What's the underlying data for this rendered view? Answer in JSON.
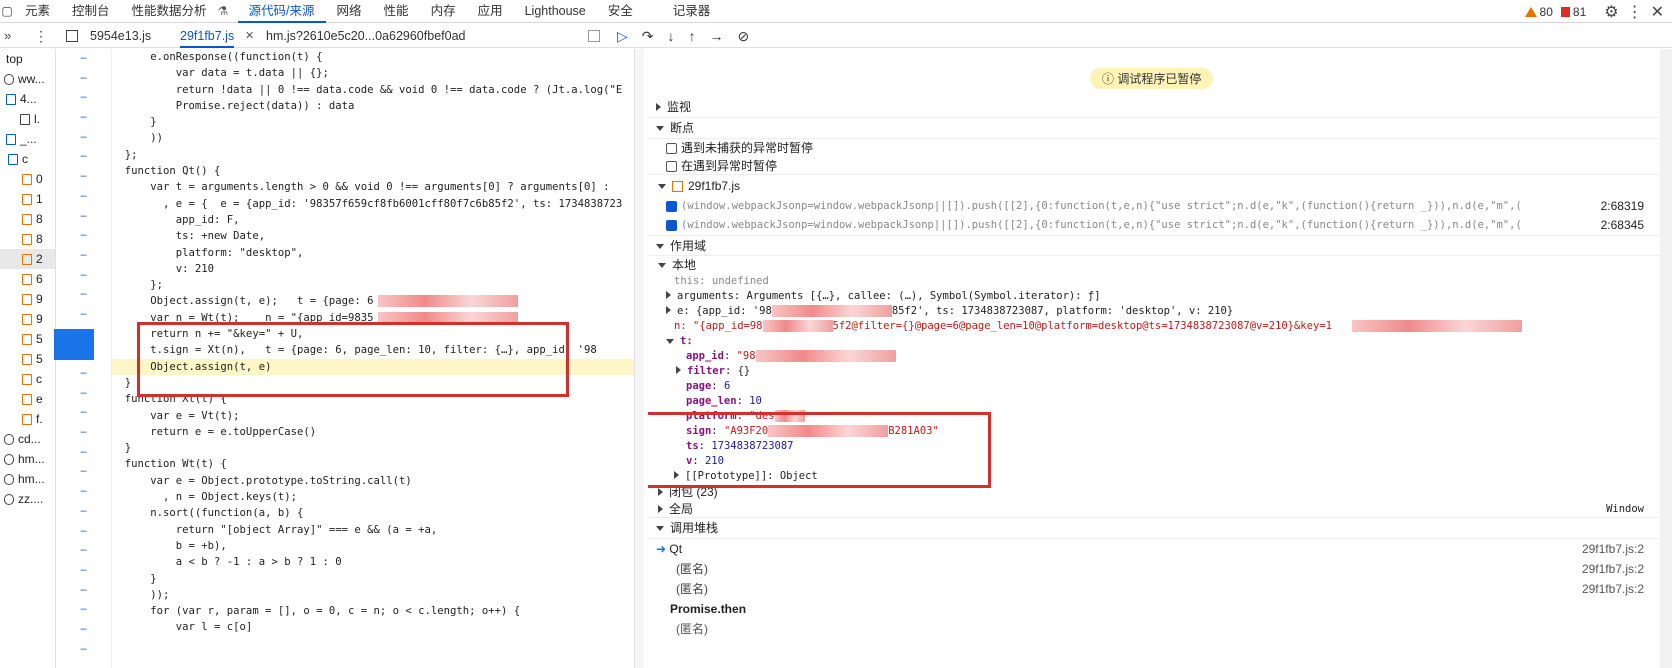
{
  "topbar": {
    "tabs": [
      "元素",
      "控制台",
      "性能数据分析",
      "源代码/来源",
      "网络",
      "性能",
      "内存",
      "应用",
      "Lighthouse",
      "安全",
      "记录器"
    ],
    "warnings": "80",
    "errors": "81"
  },
  "files": {
    "tabs": [
      "5954e13.js",
      "29f1fb7.js",
      "hm.js?2610e5c20...0a62960fbef0ad"
    ]
  },
  "tree": {
    "items": [
      "top",
      "ww...",
      "4...",
      "l.",
      "_...",
      "c",
      "0",
      "1",
      "8",
      "8",
      "2",
      "6",
      "9",
      "9",
      "5",
      "5",
      "c",
      "e",
      "f.",
      "cd...",
      "hm...",
      "hm...",
      "zz...."
    ]
  },
  "code": {
    "lines": [
      "      e.onResponse((function(t) {",
      "          var data = t.data || {};",
      "          return !data || 0 !== data.code && void 0 !== data.code ? (Jt.a.log(\"E",
      "          Promise.reject(data)) : data",
      "      }",
      "      ))",
      "  };",
      "  function Qt() {",
      "      var t = arguments.length > 0 && void 0 !== arguments[0] ? arguments[0] : ",
      "        , e = {  e = {app_id: '98357f659cf8fb6001cff80f7c6b85f2', ts: 1734838723",
      "          app_id: F,",
      "          ts: +new Date,",
      "          platform: \"desktop\",",
      "          v: 210",
      "      };",
      "      Object.assign(t, e);   t = {page: 6",
      "      var n = Wt(t);    n = \"{app_id=9835",
      "      return n += \"&key=\" + U,",
      "      t.sign = Xt(n),   t = {page: 6, page_len: 10, filter: {…}, app_id: '98",
      "      Object.assign(t, e)",
      "  }",
      "  function Xt(t) {",
      "      var e = Vt(t);",
      "      return e = e.toUpperCase()",
      "  }",
      "  function Wt(t) {",
      "      var e = Object.prototype.toString.call(t)",
      "        , n = Object.keys(t);",
      "      n.sort((function(a, b) {",
      "          return \"[object Array]\" === e && (a = +a,",
      "          b = +b),",
      "          a < b ? -1 : a > b ? 1 : 0",
      "      }",
      "      ));",
      "      for (var r, param = [], o = 0, c = n; o < c.length; o++) {",
      "          var l = c[o]"
    ]
  },
  "debugger": {
    "paused": "调试程序已暂停",
    "watch": "监视",
    "breakpoints": "断点",
    "bp_uncaught": "遇到未捕获的异常时暂停",
    "bp_caught": "在遇到异常时暂停",
    "bp_file": "29f1fb7.js",
    "bp_lines": [
      {
        "code": "(window.webpackJsonp=window.webpackJsonp||[]).push([[2],{0:function(t,e,n){\"use strict\";n.d(e,\"k\",(function(){return _})),n.d(e,\"m\",(function(){retu…",
        "loc": "2:68319"
      },
      {
        "code": "(window.webpackJsonp=window.webpackJsonp||[]).push([[2],{0:function(t,e,n){\"use strict\";n.d(e,\"k\",(function(){return _})),n.d(e,\"m\",(function(){retu…",
        "loc": "2:68345"
      }
    ],
    "scope": "作用域",
    "local": "本地",
    "this_line": "this: undefined",
    "arguments_line": "arguments: Arguments [{…}, callee: (…), Symbol(Symbol.iterator): ƒ]",
    "e_line": "e: {app_id: '98",
    "e_line_tail": "85f2', ts: 1734838723087, platform: 'desktop', v: 210}",
    "n_line": "n: \"{app_id=98",
    "n_line_tail": "5f2@filter={}@page=6@page_len=10@platform=desktop@ts=1734838723087@v=210}&key=1",
    "t_label": "t:",
    "t_props": [
      {
        "k": "app_id",
        "v": "\"98"
      },
      {
        "k": "filter",
        "v": "{}"
      },
      {
        "k": "page",
        "v": "6"
      },
      {
        "k": "page_len",
        "v": "10"
      },
      {
        "k": "platform",
        "v": "\"des"
      },
      {
        "k": "sign",
        "v": "\"A93F20"
      },
      {
        "k": "ts",
        "v": "1734838723087"
      },
      {
        "k": "v",
        "v": "210"
      }
    ],
    "sign_tail": "B281A03\"",
    "prototype": "[[Prototype]]: Object",
    "closure": "闭包 (23)",
    "global": "全局",
    "global_val": "Window",
    "callstack": "调用堆栈",
    "frames": [
      {
        "name": "Qt",
        "loc": "29f1fb7.js:2"
      },
      {
        "name": "(匿名)",
        "loc": "29f1fb7.js:2"
      },
      {
        "name": "(匿名)",
        "loc": "29f1fb7.js:2"
      }
    ],
    "promise": "Promise.then",
    "last_frame": "(匿名)"
  }
}
